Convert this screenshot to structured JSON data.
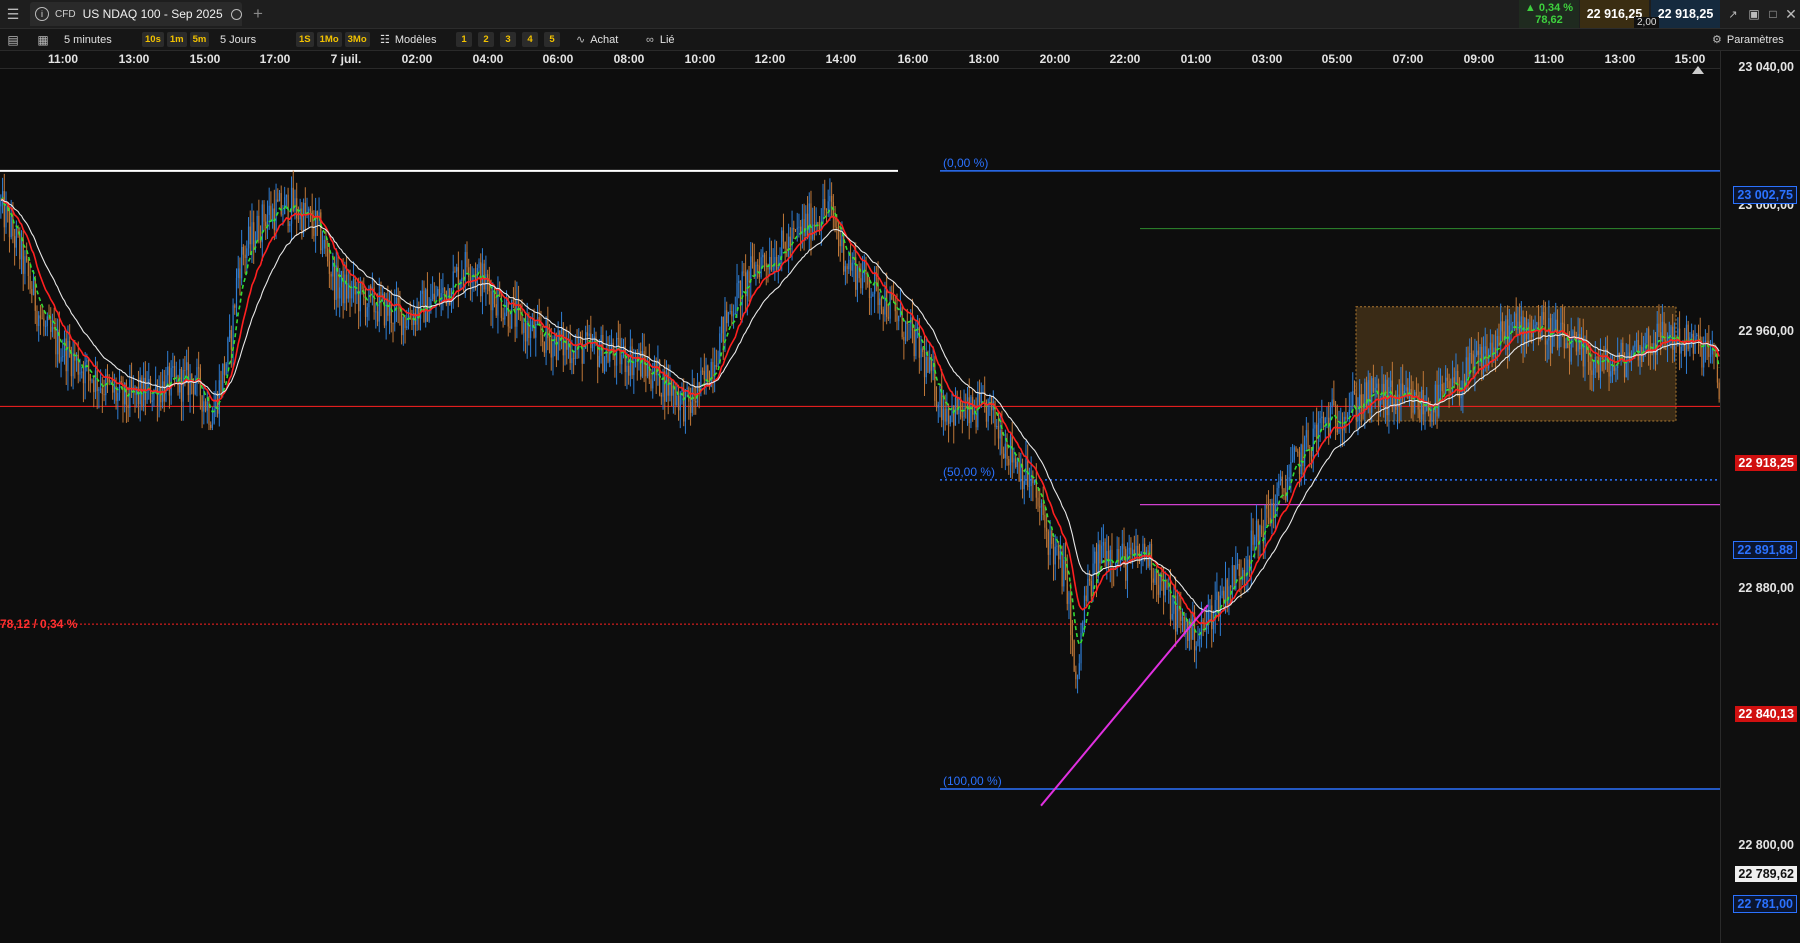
{
  "window": {
    "tab_badge": "CFD",
    "instrument": "US NDAQ 100 - Sep 2025",
    "change_pct": "▲ 0,34 %",
    "change_abs": "78,62",
    "bid": "22 916,25",
    "ask": "22 918,25",
    "spread": "2,00"
  },
  "toolbar": {
    "interval": "5 minutes",
    "interval_presets": [
      "10s",
      "1m",
      "5m"
    ],
    "range": "5 Jours",
    "range_presets": [
      "1S",
      "1Mo",
      "3Mo"
    ],
    "templates_label": "Modèles",
    "template_slots": [
      "1",
      "2",
      "3",
      "4",
      "5"
    ],
    "order_label": "Achat",
    "link_label": "Lié",
    "settings_label": "Paramètres"
  },
  "colors": {
    "bull": "#2f7fd6",
    "bear": "#c07838",
    "ema_fast": "#33dd33",
    "ema_mid": "#ff2020",
    "ema_slow": "#e8e8e8",
    "fib": "#2b72ff",
    "price_line": "#ff2020",
    "trendline": "#e030e0",
    "zone": "#b07a30"
  },
  "chart_data": {
    "type": "candlestick",
    "timeframe": "5 minutes",
    "x_tick_labels": [
      "11:00",
      "13:00",
      "15:00",
      "17:00",
      "7 juil.",
      "02:00",
      "04:00",
      "06:00",
      "08:00",
      "10:00",
      "12:00",
      "14:00",
      "16:00",
      "18:00",
      "20:00",
      "22:00",
      "01:00",
      "03:00",
      "05:00",
      "07:00",
      "09:00",
      "11:00",
      "13:00",
      "15:00"
    ],
    "y_tick_labels": [
      "23 040,00",
      "23 000,00",
      "22 960,00",
      "22 880,00",
      "22 800,00"
    ],
    "ylim": [
      22775,
      23045
    ],
    "price_path": [
      [
        0,
        22990
      ],
      [
        2,
        22975
      ],
      [
        5,
        22945
      ],
      [
        10,
        22930
      ],
      [
        14,
        22920
      ],
      [
        18,
        22925
      ],
      [
        22,
        22928
      ],
      [
        24,
        22915
      ],
      [
        26,
        22940
      ],
      [
        27,
        22970
      ],
      [
        30,
        22987
      ],
      [
        33,
        22990
      ],
      [
        36,
        22982
      ],
      [
        38,
        22962
      ],
      [
        42,
        22955
      ],
      [
        46,
        22950
      ],
      [
        50,
        22958
      ],
      [
        53,
        22970
      ],
      [
        56,
        22958
      ],
      [
        60,
        22945
      ],
      [
        64,
        22940
      ],
      [
        68,
        22938
      ],
      [
        72,
        22935
      ],
      [
        76,
        22925
      ],
      [
        78,
        22918
      ],
      [
        80,
        22928
      ],
      [
        83,
        22955
      ],
      [
        86,
        22970
      ],
      [
        89,
        22975
      ],
      [
        92,
        22985
      ],
      [
        94,
        22990
      ],
      [
        96,
        22970
      ],
      [
        100,
        22958
      ],
      [
        104,
        22940
      ],
      [
        107,
        22918
      ],
      [
        110,
        22915
      ],
      [
        112,
        22918
      ],
      [
        114,
        22905
      ],
      [
        117,
        22890
      ],
      [
        119,
        22870
      ],
      [
        121,
        22855
      ],
      [
        122,
        22815
      ],
      [
        123,
        22848
      ],
      [
        125,
        22868
      ],
      [
        128,
        22862
      ],
      [
        130,
        22866
      ],
      [
        132,
        22852
      ],
      [
        134,
        22840
      ],
      [
        136,
        22836
      ],
      [
        138,
        22848
      ],
      [
        141,
        22862
      ],
      [
        144,
        22880
      ],
      [
        147,
        22898
      ],
      [
        150,
        22912
      ],
      [
        153,
        22918
      ],
      [
        156,
        22922
      ],
      [
        159,
        22920
      ],
      [
        162,
        22918
      ],
      [
        165,
        22925
      ],
      [
        168,
        22935
      ],
      [
        171,
        22945
      ],
      [
        174,
        22948
      ],
      [
        177,
        22942
      ],
      [
        180,
        22935
      ],
      [
        183,
        22932
      ],
      [
        186,
        22940
      ],
      [
        189,
        22944
      ],
      [
        192,
        22940
      ],
      [
        194,
        22938
      ],
      [
        195,
        22925
      ]
    ],
    "indicators": [
      {
        "type": "ema_fast",
        "color": "#33dd33"
      },
      {
        "type": "ema_mid",
        "color": "#ff2020"
      },
      {
        "type": "ema_slow",
        "color": "#e8e8e8"
      }
    ],
    "fibonacci": [
      {
        "label": "(0,00 %)",
        "price": 23002.75,
        "tag": "23 002,75"
      },
      {
        "label": "(50,00 %)",
        "price": 22891.88,
        "tag": "22 891,88"
      },
      {
        "label": "(100,00 %)",
        "price": 22781.0,
        "tag": "22 781,00"
      }
    ],
    "horizontal_lines": [
      {
        "price": 23002.75,
        "color": "#ffffff"
      },
      {
        "price": 22982,
        "color": "#2e8b2e"
      },
      {
        "price": 22883,
        "color": "#d040d0"
      }
    ],
    "current_price": {
      "price": 22918.25,
      "tag": "22 918,25"
    },
    "previous_close": {
      "price": 22840.13,
      "tag": "22 840,13",
      "change_label": "78,12 / 0,34 %"
    },
    "cursor_price": {
      "price": 22789.62,
      "tag": "22 789,62"
    },
    "trendline": [
      [
        22781,
        121
      ],
      [
        22845,
        134
      ]
    ],
    "zone": {
      "x_start": 0,
      "x_end": 0,
      "price_high": 22954,
      "price_low": 22913
    }
  }
}
